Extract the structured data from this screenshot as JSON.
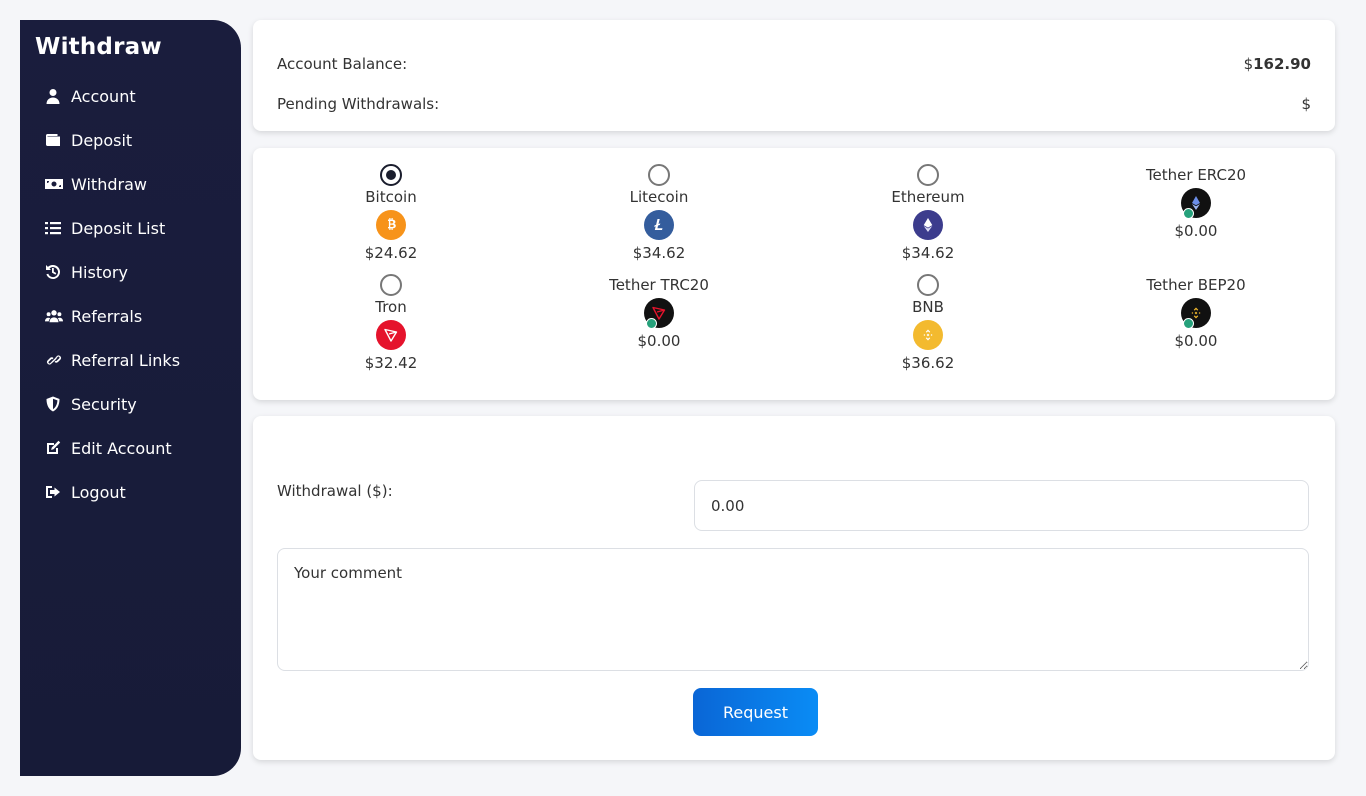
{
  "sidebar": {
    "title": "Withdraw",
    "items": [
      {
        "label": "Account",
        "icon": "user-icon"
      },
      {
        "label": "Deposit",
        "icon": "wallet-icon"
      },
      {
        "label": "Withdraw",
        "icon": "money-bill-icon"
      },
      {
        "label": "Deposit List",
        "icon": "list-icon"
      },
      {
        "label": "History",
        "icon": "history-icon"
      },
      {
        "label": "Referrals",
        "icon": "users-icon"
      },
      {
        "label": "Referral Links",
        "icon": "link-icon"
      },
      {
        "label": "Security",
        "icon": "shield-icon"
      },
      {
        "label": "Edit Account",
        "icon": "edit-icon"
      },
      {
        "label": "Logout",
        "icon": "logout-icon"
      }
    ]
  },
  "balance": {
    "account_label": "Account Balance:",
    "currency_symbol": "$",
    "account_value": "162.90",
    "pending_label": "Pending Withdrawals:",
    "pending_value": "$"
  },
  "coins": [
    {
      "name": "Bitcoin",
      "amount": "$24.62",
      "selectable": true,
      "selected": true,
      "icon": "bitcoin-icon",
      "color": "#f7931a"
    },
    {
      "name": "Litecoin",
      "amount": "$34.62",
      "selectable": true,
      "selected": false,
      "icon": "litecoin-icon",
      "color": "#345d9d"
    },
    {
      "name": "Ethereum",
      "amount": "$34.62",
      "selectable": true,
      "selected": false,
      "icon": "ethereum-icon",
      "color": "#3c3c8d"
    },
    {
      "name": "Tether ERC20",
      "amount": "$0.00",
      "selectable": false,
      "selected": false,
      "icon": "tether-erc20-icon",
      "color": "#111111"
    },
    {
      "name": "Tron",
      "amount": "$32.42",
      "selectable": true,
      "selected": false,
      "icon": "tron-icon",
      "color": "#e5132c"
    },
    {
      "name": "Tether TRC20",
      "amount": "$0.00",
      "selectable": false,
      "selected": false,
      "icon": "tether-trc20-icon",
      "color": "#111111"
    },
    {
      "name": "BNB",
      "amount": "$36.62",
      "selectable": true,
      "selected": false,
      "icon": "bnb-icon",
      "color": "#f3ba2f"
    },
    {
      "name": "Tether BEP20",
      "amount": "$0.00",
      "selectable": false,
      "selected": false,
      "icon": "tether-bep20-icon",
      "color": "#111111"
    }
  ],
  "form": {
    "withdrawal_label": "Withdrawal ($):",
    "withdrawal_value": "0.00",
    "comment_placeholder": "Your comment",
    "request_label": "Request"
  },
  "colors": {
    "sidebar_bg": "#1a1d3d",
    "accent": "#0a7ae8",
    "page_bg": "#f5f6f9"
  }
}
